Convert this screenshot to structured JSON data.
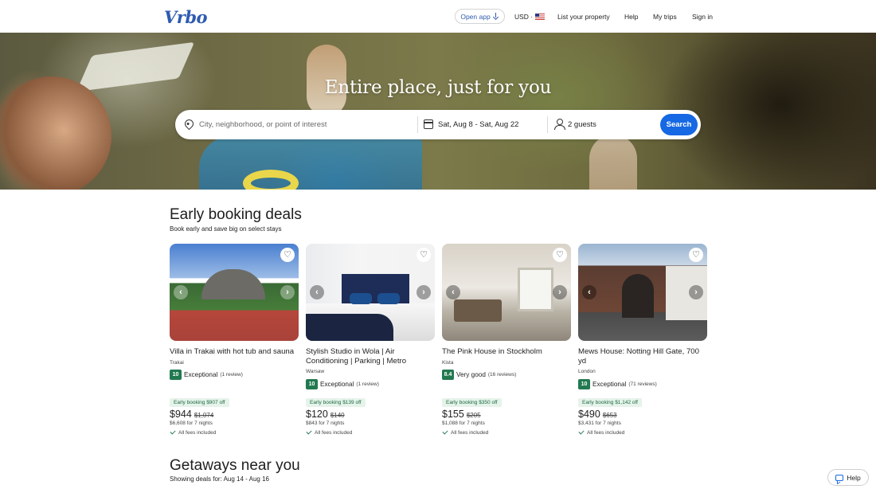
{
  "header": {
    "logo": "Vrbo",
    "open_app": "Open app",
    "currency": "USD ·",
    "links": [
      "List your property",
      "Help",
      "My trips",
      "Sign in"
    ]
  },
  "hero": {
    "title": "Entire place, just for you"
  },
  "search": {
    "destination_placeholder": "City, neighborhood, or point of interest",
    "dates": "Sat, Aug 8 - Sat, Aug 22",
    "guests": "2 guests",
    "button": "Search"
  },
  "deals": {
    "title": "Early booking deals",
    "subtitle": "Book early and save big on select stays",
    "cards": [
      {
        "title": "Villa in Trakai with hot tub and sauna",
        "location": "Trakai",
        "score": "10",
        "rating": "Exceptional",
        "reviews": "(1 review)",
        "deal": "Early booking $907 off",
        "price": "$944",
        "old_price": "$1,074",
        "total": "$6,608 for 7 nights",
        "fees": "All fees included"
      },
      {
        "title": "Stylish Studio in Wola | Air Conditioning | Parking | Metro",
        "location": "Warsaw",
        "score": "10",
        "rating": "Exceptional",
        "reviews": "(1 review)",
        "deal": "Early booking $139 off",
        "price": "$120",
        "old_price": "$140",
        "total": "$843 for 7 nights",
        "fees": "All fees included"
      },
      {
        "title": "The Pink House in Stockholm",
        "location": "Kista",
        "score": "8.4",
        "rating": "Very good",
        "reviews": "(16 reviews)",
        "deal": "Early booking $350 off",
        "price": "$155",
        "old_price": "$205",
        "total": "$1,088 for 7 nights",
        "fees": "All fees included"
      },
      {
        "title": "Mews House: Notting Hill Gate, 700 yd",
        "location": "London",
        "score": "10",
        "rating": "Exceptional",
        "reviews": "(71 reviews)",
        "deal": "Early booking $1,142 off",
        "price": "$490",
        "old_price": "$653",
        "total": "$3,431 for 7 nights",
        "fees": "All fees included"
      }
    ]
  },
  "getaways": {
    "title": "Getaways near you",
    "subtitle": "Showing deals for: Aug 14 - Aug 16"
  },
  "help_button": "Help",
  "colors": {
    "primary": "#1668e3",
    "logo": "#2e5bb0",
    "rating_green": "#227950"
  }
}
